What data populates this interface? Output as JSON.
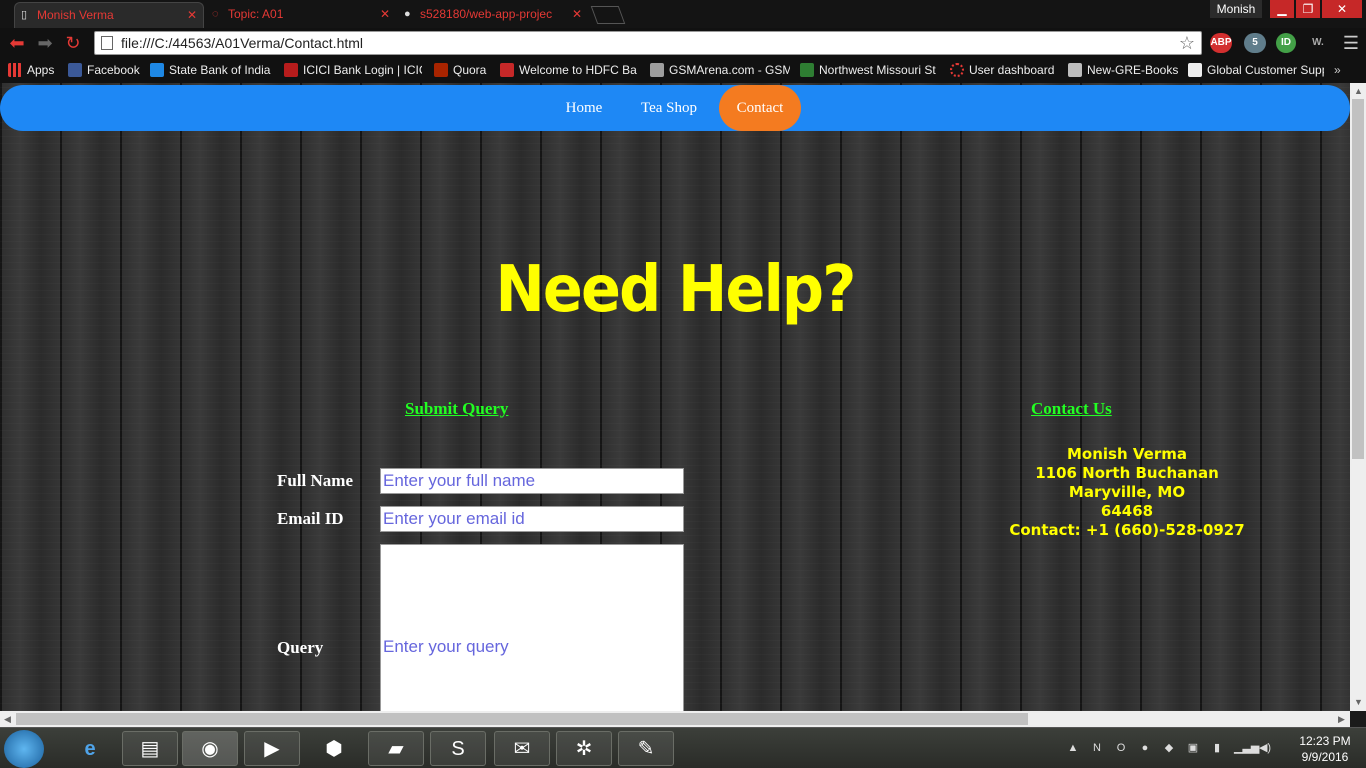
{
  "browser": {
    "tabs": [
      {
        "label": "Monish Verma",
        "active": true
      },
      {
        "label": "Topic: A01",
        "active": false
      },
      {
        "label": "s528180/web-app-projec",
        "active": false
      }
    ],
    "profile_name": "Monish",
    "url": "file:///C:/44563/A01Verma/Contact.html",
    "extensions": [
      "ABP",
      "5",
      "ID",
      "W."
    ],
    "bookmarks": [
      "Apps",
      "Facebook",
      "State Bank of India",
      "ICICI Bank Login | ICIC",
      "Quora",
      "Welcome to HDFC Ba",
      "GSMArena.com - GSM",
      "Northwest Missouri St",
      "User dashboard",
      "New-GRE-Books",
      "Global Customer Supp"
    ]
  },
  "page": {
    "nav": [
      "Home",
      "Tea Shop",
      "Contact"
    ],
    "heading": "Need Help?",
    "submit_title": "Submit Query",
    "contact_title": "Contact Us",
    "form": {
      "full_name_label": "Full Name",
      "full_name_placeholder": "Enter your full name",
      "email_label": "Email ID",
      "email_placeholder": "Enter your email id",
      "query_label": "Query",
      "query_placeholder": "Enter your query"
    },
    "contact": {
      "name": "Monish Verma",
      "street": "1106 North Buchanan",
      "city": "Maryville, MO",
      "zip": "64468",
      "phone": "Contact: +1 (660)-528-0927"
    }
  },
  "taskbar": {
    "time": "12:23 PM",
    "date": "9/9/2016"
  },
  "colors": {
    "nav_bar": "#1e88f5",
    "nav_active": "#f47b20",
    "heading": "#ffff00",
    "section_title": "#22ff22",
    "tab_text": "#e53935"
  }
}
